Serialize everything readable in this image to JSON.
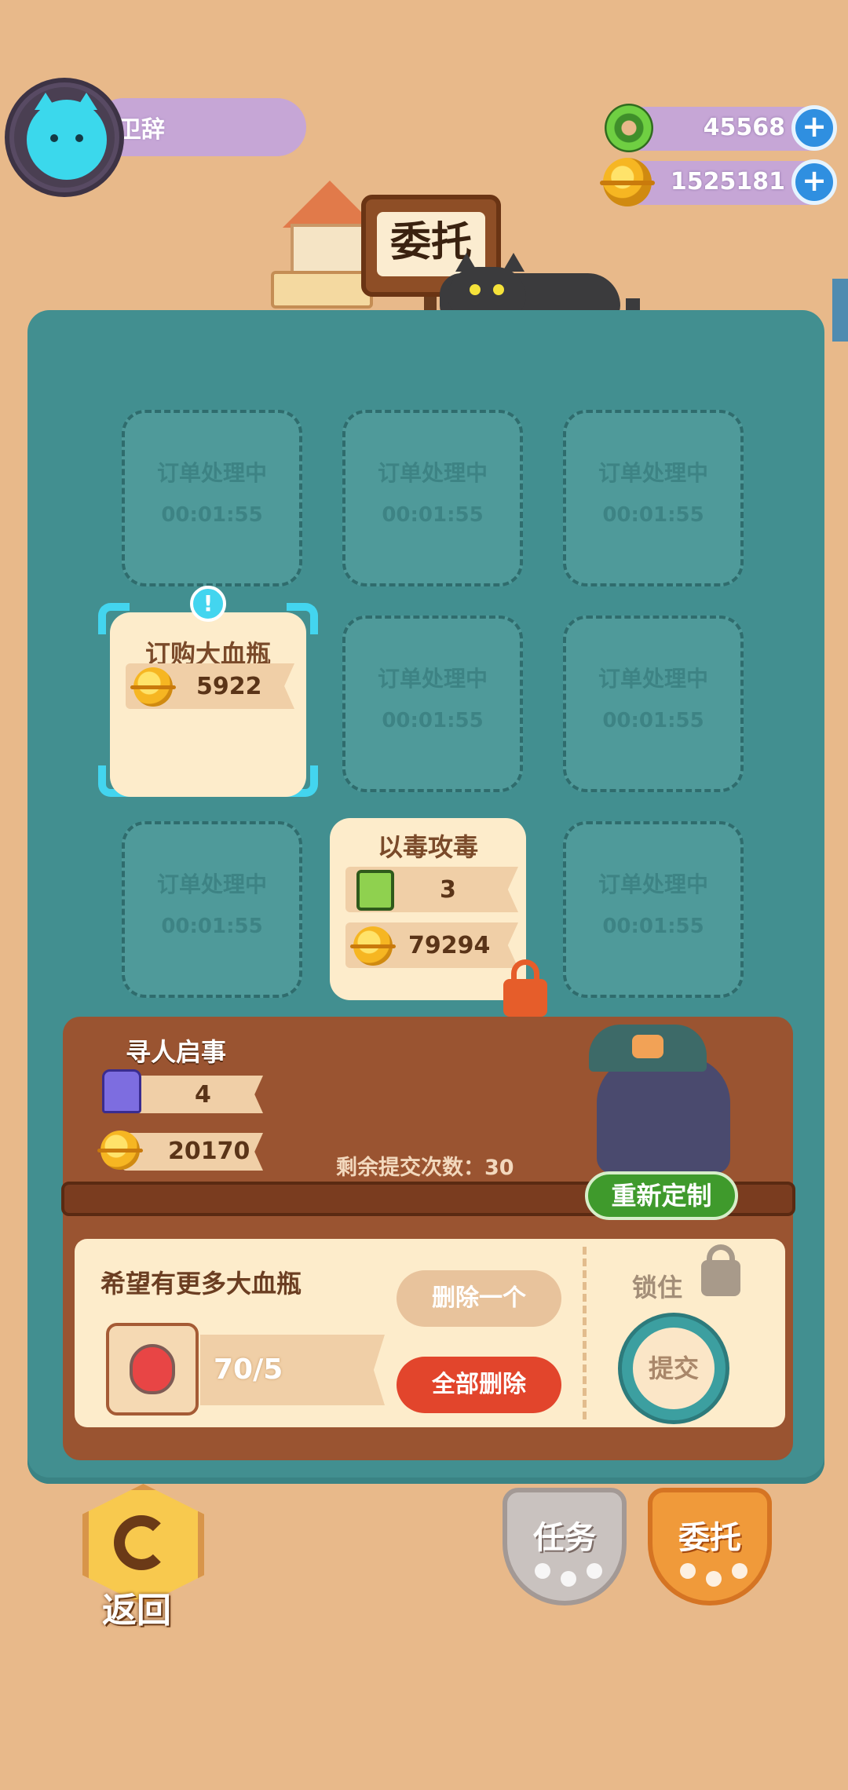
{
  "profile": {
    "name": "卫辞"
  },
  "currency": {
    "gems": {
      "value": "45568",
      "icon": "donut-gem-icon"
    },
    "coins": {
      "value": "1525181",
      "icon": "gold-coin-icon"
    }
  },
  "header": {
    "title": "委托"
  },
  "slots": {
    "pending_title": "订单处理中",
    "pending_time": "00:01:55"
  },
  "orders": [
    {
      "title": "订购大血瓶",
      "reward_coins": "5922",
      "selected": true
    },
    {
      "title": "以毒攻毒",
      "reward_batteries": "3",
      "reward_coins": "79294",
      "locked": true
    }
  ],
  "quest": {
    "title": "寻人启事",
    "reward_screws": "4",
    "reward_coins": "20170",
    "remaining_label": "剩余提交次数：30",
    "redesign_label": "重新定制"
  },
  "request": {
    "text": "希望有更多大血瓶",
    "progress": "70/5",
    "delete_one_label": "删除一个",
    "delete_all_label": "全部删除",
    "lock_label": "锁住",
    "submit_label": "提交"
  },
  "footer": {
    "back_label": "返回",
    "tabs": [
      {
        "label": "任务",
        "active": false
      },
      {
        "label": "委托",
        "active": true
      }
    ]
  },
  "colors": {
    "background": "#e8b98a",
    "board": "#428f90",
    "panel": "#9a5431",
    "accent_cyan": "#43d5ef",
    "delete_red": "#e2452c",
    "redesign_green": "#3f9a2c"
  }
}
